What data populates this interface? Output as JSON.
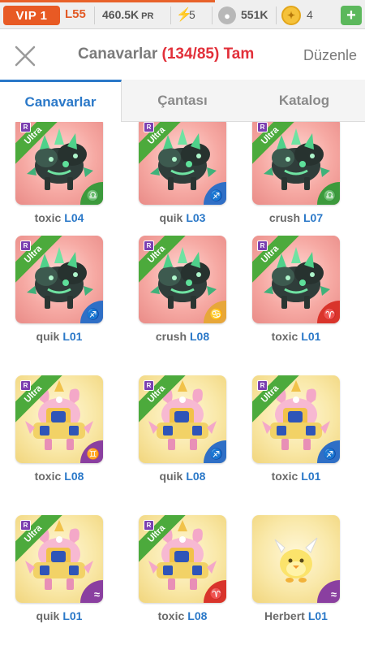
{
  "status": {
    "vip": "VIP 1",
    "level": "L55",
    "power": "460.5K",
    "power_unit": "PR",
    "energy": "5",
    "food": "551K",
    "gold": "4",
    "plus_label": "+"
  },
  "header": {
    "title": "Canavarlar",
    "count": "(134/85)",
    "suffix": "Tam",
    "edit_label": "Düzenle"
  },
  "tabs": [
    {
      "label": "Canavarlar"
    },
    {
      "label": "Çantası"
    },
    {
      "label": "Katalog"
    }
  ],
  "colors": {
    "accent": "#2a78c8",
    "count_red": "#e2303a",
    "element_blue": "#2f6fc6",
    "element_green": "#3c9a3c",
    "element_purple": "#8a3fa0",
    "element_red": "#d9342b",
    "element_orange": "#e7a73a"
  },
  "monsters": [
    {
      "name": "toxic",
      "level": "L04",
      "bg": "pink",
      "species": "dragon",
      "element": "element_green",
      "element_icon": "♎",
      "ultra": "Ultra",
      "rarity": "R",
      "show_ribbon": true
    },
    {
      "name": "quik",
      "level": "L03",
      "bg": "pink",
      "species": "dragon",
      "element": "element_blue",
      "element_icon": "♐",
      "ultra": "Ultra",
      "rarity": "R",
      "show_ribbon": true
    },
    {
      "name": "crush",
      "level": "L07",
      "bg": "pink",
      "species": "dragon",
      "element": "element_green",
      "element_icon": "♎",
      "ultra": "Ultra",
      "rarity": "R",
      "show_ribbon": true
    },
    {
      "name": "quik",
      "level": "L01",
      "bg": "pink",
      "species": "dragon",
      "element": "element_blue",
      "element_icon": "♐",
      "ultra": "Ultra",
      "rarity": "R",
      "show_ribbon": true
    },
    {
      "name": "crush",
      "level": "L08",
      "bg": "pink",
      "species": "dragon",
      "element": "element_orange",
      "element_icon": "♋",
      "ultra": "Ultra",
      "rarity": "R",
      "show_ribbon": true
    },
    {
      "name": "toxic",
      "level": "L01",
      "bg": "pink",
      "species": "dragon",
      "element": "element_red",
      "element_icon": "♈",
      "ultra": "Ultra",
      "rarity": "R",
      "show_ribbon": true
    },
    {
      "name": "toxic",
      "level": "L08",
      "bg": "yellow",
      "species": "knight",
      "element": "element_purple",
      "element_icon": "♊",
      "ultra": "Ultra",
      "rarity": "R",
      "show_ribbon": true
    },
    {
      "name": "quik",
      "level": "L08",
      "bg": "yellow",
      "species": "knight",
      "element": "element_blue",
      "element_icon": "♐",
      "ultra": "Ultra",
      "rarity": "R",
      "show_ribbon": true
    },
    {
      "name": "toxic",
      "level": "L01",
      "bg": "yellow",
      "species": "knight",
      "element": "element_blue",
      "element_icon": "♐",
      "ultra": "Ultra",
      "rarity": "R",
      "show_ribbon": true
    },
    {
      "name": "quik",
      "level": "L01",
      "bg": "yellow",
      "species": "knight",
      "element": "element_purple",
      "element_icon": "≈",
      "ultra": "Ultra",
      "rarity": "R",
      "show_ribbon": true
    },
    {
      "name": "toxic",
      "level": "L08",
      "bg": "yellow",
      "species": "knight",
      "element": "element_red",
      "element_icon": "♈",
      "ultra": "Ultra",
      "rarity": "R",
      "show_ribbon": true
    },
    {
      "name": "Herbert",
      "level": "L01",
      "bg": "yellow",
      "species": "chick",
      "element": "element_purple",
      "element_icon": "≈",
      "ultra": "",
      "rarity": "",
      "show_ribbon": false
    }
  ]
}
